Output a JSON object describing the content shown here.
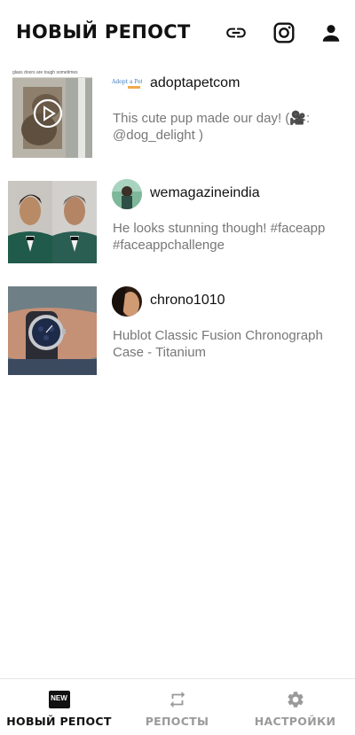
{
  "header": {
    "title": "НОВЫЙ РЕПОСТ"
  },
  "posts": [
    {
      "username": "adoptapetcom",
      "caption": "This cute pup made our day! (🎥: @dog_delight )",
      "thumb_overlay_text": "glass doors are tough sometimes",
      "avatar_text": "Adopt a Pet"
    },
    {
      "username": "wemagazineindia",
      "caption": "He looks stunning though! #faceapp #faceappchallenge"
    },
    {
      "username": "chrono1010",
      "caption": "Hublot Classic Fusion Chronograph Case - Titanium"
    }
  ],
  "bottom_nav": {
    "tabs": [
      {
        "label": "НОВЫЙ РЕПОСТ",
        "icon_text": "NEW",
        "active": true
      },
      {
        "label": "РЕПОСТЫ",
        "active": false
      },
      {
        "label": "НАСТРОЙКИ",
        "active": false
      }
    ]
  },
  "colors": {
    "active": "#111111",
    "inactive": "#9a9a9a",
    "caption": "#777777"
  }
}
